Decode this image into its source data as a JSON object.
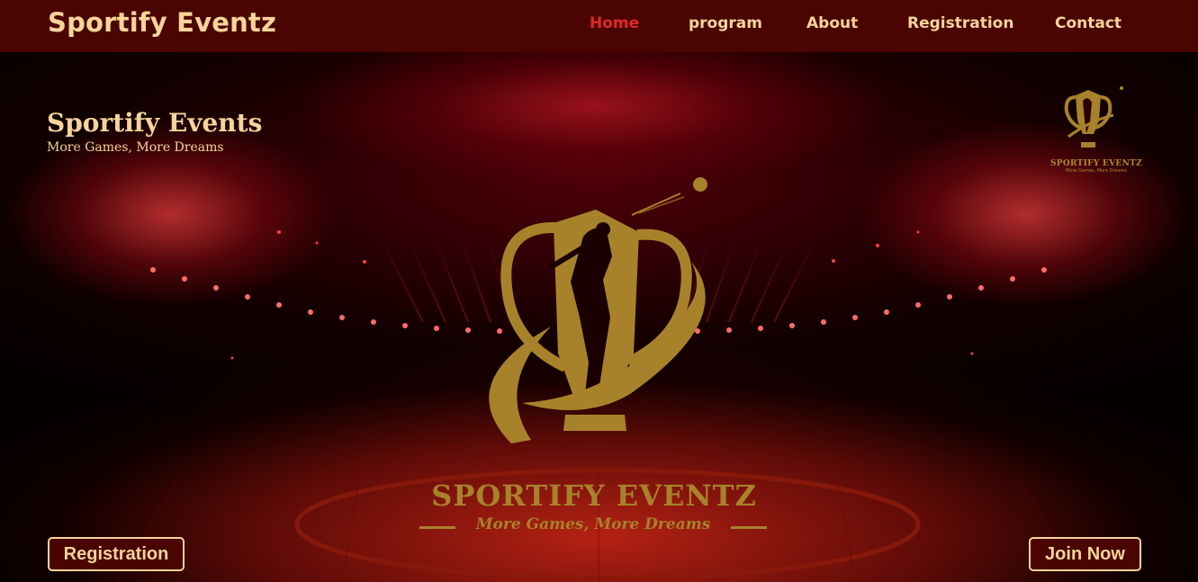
{
  "brand": "Sportify Eventz",
  "nav": {
    "items": [
      {
        "label": "Home",
        "active": true
      },
      {
        "label": "program",
        "active": false
      },
      {
        "label": "About",
        "active": false
      },
      {
        "label": "Registration",
        "active": false
      },
      {
        "label": "Contact",
        "active": false
      }
    ]
  },
  "hero": {
    "title": "Sportify Events",
    "subtitle": "More Games, More Dreams",
    "logo_name": "SPORTIFY EVENTZ",
    "logo_tagline": "More Games, More Dreams",
    "small_logo_name": "SPORTIFY EVENTZ",
    "small_logo_tagline": "More Games, More Dreams",
    "background_image": "stadium-lights-background"
  },
  "buttons": {
    "registration": "Registration",
    "join": "Join Now"
  },
  "colors": {
    "navbar_bg": "#4a0501",
    "nav_text": "#f7d49a",
    "nav_active": "#e02a25",
    "logo_gold": "#a8822b"
  },
  "icons": [
    "trophy-logo-icon",
    "cricket-player-icon",
    "ball-icon"
  ]
}
